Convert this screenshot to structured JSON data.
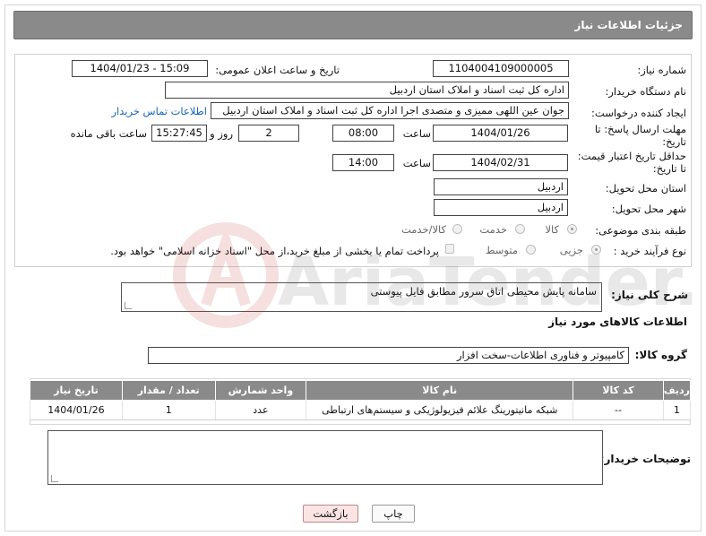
{
  "header": {
    "title": "جزئیات اطلاعات نیاز"
  },
  "fields": {
    "need_number_label": "شماره نیاز:",
    "need_number": "1104004109000005",
    "announce_label": "تاریخ و ساعت اعلان عمومی:",
    "announce_value": "1404/01/23 - 15:09",
    "buyer_org_label": "نام دستگاه خریدار:",
    "buyer_org": "اداره کل ثبت اسناد و املاک استان اردبیل",
    "creator_label": "ایجاد کننده درخواست:",
    "creator": "جوان  عین اللهی ممیزی و متصدی اجرا اداره کل ثبت اسناد و املاک استان اردبیل",
    "contact_link": "اطلاعات تماس خریدار",
    "deadline_label": "مهلت ارسال پاسخ: تا تاریخ:",
    "deadline_date": "1404/01/26",
    "time_label": "ساعت",
    "deadline_time": "08:00",
    "days_value": "2",
    "days_label": "روز و",
    "remaining_time": "15:27:45",
    "remaining_label": "ساعت باقی مانده",
    "validity_label": "حداقل تاریخ اعتبار قیمت: تا تاریخ:",
    "validity_date": "1404/02/31",
    "validity_time": "14:00",
    "province_label": "استان محل تحویل:",
    "province": "اردبیل",
    "city_label": "شهر محل تحویل:",
    "city": "اردبیل",
    "category_label": "طبقه بندی موضوعی:",
    "category_options": [
      "کالا",
      "خدمت",
      "کالا/خدمت"
    ],
    "process_label": "نوع فرآیند خرید :",
    "process_options": [
      "جزیی",
      "متوسط"
    ],
    "payment_note": "پرداخت تمام یا بخشی از مبلغ خرید،از محل \"اسناد خزانه اسلامی\" خواهد بود."
  },
  "summary": {
    "label": "شرح کلی نیاز:",
    "value": "سامانه پایش محیطی اتاق سرور مطابق فایل پیوستی"
  },
  "goods": {
    "section_title": "اطلاعات کالاهای مورد نیاز",
    "group_label": "گروه کالا:",
    "group_value": "کامپیوتر و فناوری اطلاعات-سخت افزار",
    "columns": [
      "ردیف",
      "کد کالا",
      "نام کالا",
      "واحد شمارش",
      "تعداد / مقدار",
      "تاریخ نیاز"
    ],
    "rows": [
      [
        "1",
        "--",
        "شبکه مانیتورینگ علائم فیزیولوژیکی و سیستم‌های ارتباطی",
        "عدد",
        "1",
        "1404/01/26"
      ]
    ]
  },
  "buyer_notes": {
    "label": "توضیحات خریدار:",
    "value": ""
  },
  "buttons": {
    "print": "چاپ",
    "back": "بازگشت"
  },
  "watermark": {
    "text": "AriaTender.neT"
  }
}
